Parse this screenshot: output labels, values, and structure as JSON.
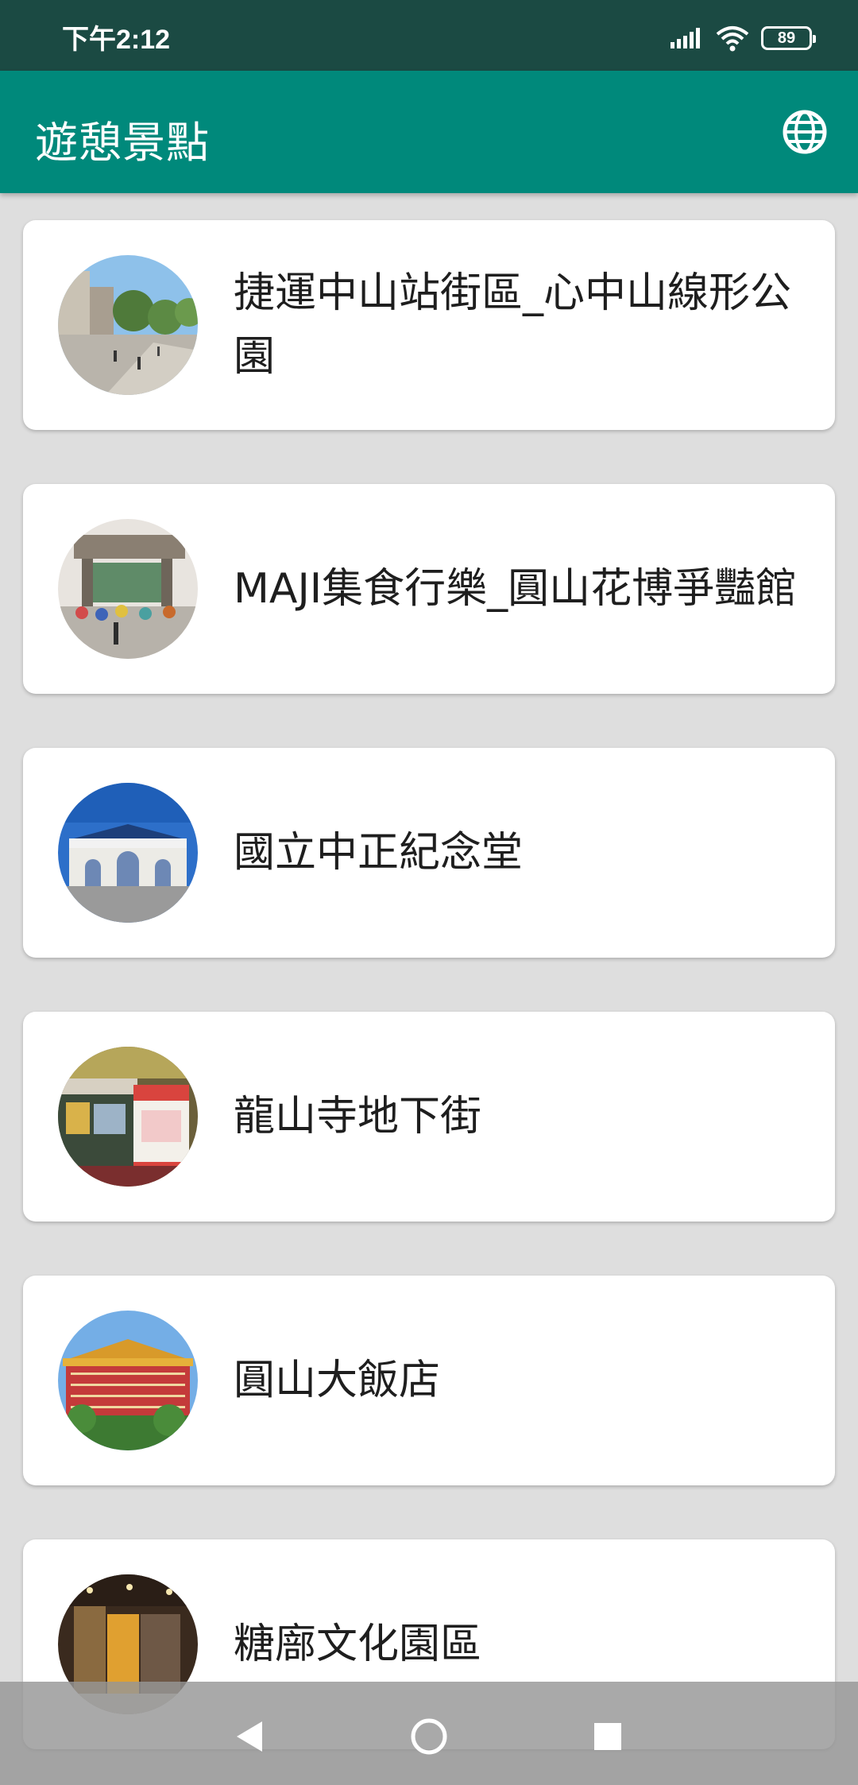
{
  "status_bar": {
    "time": "下午2:12",
    "battery": "89"
  },
  "app_bar": {
    "title": "遊憩景點",
    "language_icon": "globe-icon"
  },
  "attractions": [
    {
      "name": "捷運中山站街區_心中山線形公園",
      "image": "street-park-photo"
    },
    {
      "name": "MAJI集食行樂_圓山花博爭豔館",
      "image": "market-entrance-photo"
    },
    {
      "name": "國立中正紀念堂",
      "image": "memorial-gate-photo"
    },
    {
      "name": "龍山寺地下街",
      "image": "underground-mall-photo"
    },
    {
      "name": "圓山大飯店",
      "image": "grand-hotel-photo"
    },
    {
      "name": "糖廍文化園區",
      "image": "cultural-park-photo"
    }
  ],
  "nav_bar": {
    "back": "back-icon",
    "home": "home-icon",
    "recents": "recents-icon"
  },
  "colors": {
    "primary": "#00897b",
    "status_bar": "#1b4a43",
    "background": "#dedede"
  }
}
